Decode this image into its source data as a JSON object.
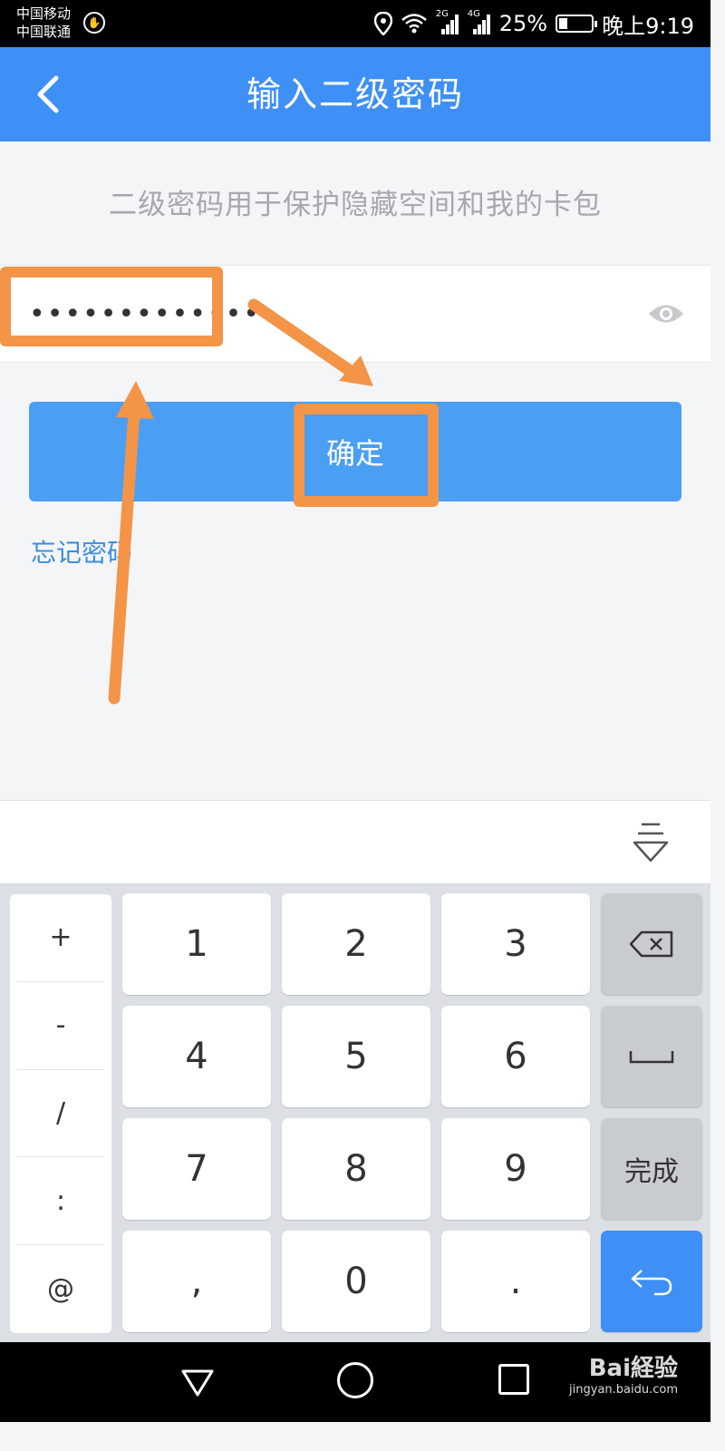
{
  "status_bar": {
    "carrier_1": "中国移动",
    "carrier_2": "中国联通",
    "net_1": "2G",
    "net_2": "4G",
    "battery": "25%",
    "battery_level": 0.25,
    "time": "晚上9:19"
  },
  "header": {
    "title": "输入二级密码",
    "back_icon": "chevron-left-icon"
  },
  "subtitle": "二级密码用于保护隐藏空间和我的卡包",
  "password": {
    "value": "•••••••••••••",
    "toggle_icon": "eye-icon"
  },
  "confirm_button": "确定",
  "forgot_link": "忘记密码",
  "keyboard": {
    "side_keys": [
      "+",
      "-",
      "/",
      ":",
      "@"
    ],
    "digits": [
      "1",
      "2",
      "3",
      "4",
      "5",
      "6",
      "7",
      "8",
      "9",
      ",",
      "0",
      "."
    ],
    "done_label": "完成",
    "icons": [
      "backspace-icon",
      "space-icon",
      "enter-icon",
      "collapse-keyboard-icon"
    ]
  },
  "watermark": {
    "brand": "Bai経验",
    "url": "jingyan.baidu.com"
  },
  "colors": {
    "primary": "#3e8ff6",
    "button": "#4a9ff5",
    "link": "#3b8de0",
    "annotation": "#f39447"
  }
}
